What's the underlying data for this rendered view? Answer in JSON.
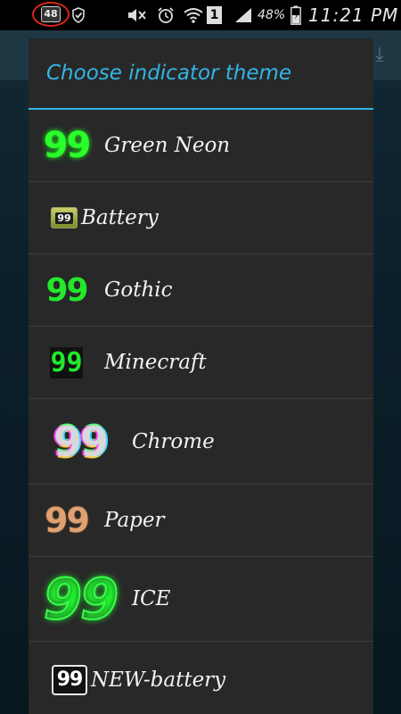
{
  "status_bar": {
    "notification_badge": "48",
    "battery_percent": "48%",
    "sim_slot": "1",
    "time": "11:21 PM"
  },
  "dialog": {
    "title": "Choose indicator theme",
    "items": [
      {
        "label": "Green Neon",
        "thumb": "99"
      },
      {
        "label": "Battery",
        "thumb": "99"
      },
      {
        "label": "Gothic",
        "thumb": "99"
      },
      {
        "label": "Minecraft",
        "thumb": "99"
      },
      {
        "label": "Chrome",
        "thumb": "99"
      },
      {
        "label": "Paper",
        "thumb": "99"
      },
      {
        "label": "ICE",
        "thumb": "99"
      },
      {
        "label": "NEW-battery",
        "thumb": "99"
      }
    ]
  },
  "colors": {
    "accent": "#33b5e5",
    "dialog_bg": "#282828",
    "highlight_ring": "#d9261c"
  },
  "icons": [
    "shield-check-icon",
    "mute-icon",
    "alarm-icon",
    "wifi-icon",
    "signal-icon",
    "battery-icon",
    "download-icon"
  ]
}
